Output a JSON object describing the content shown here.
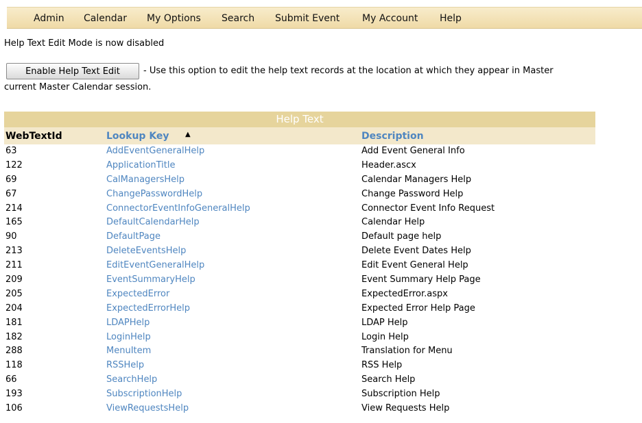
{
  "menu": [
    {
      "label": "Admin"
    },
    {
      "label": "Calendar"
    },
    {
      "label": "My Options"
    },
    {
      "label": "Search"
    },
    {
      "label": "Submit Event"
    },
    {
      "label": "My Account"
    },
    {
      "label": "Help"
    }
  ],
  "status_message": "Help Text Edit Mode is now disabled",
  "enable_button_label": "Enable Help Text Edit",
  "description_line1": "- Use this option to edit the help text records at the location at which they appear in Master",
  "description_line2": "current Master Calendar session.",
  "table": {
    "title": "Help Text",
    "headers": {
      "id": "WebTextId",
      "key": "Lookup Key",
      "desc": "Description",
      "sort_indicator": "▲"
    },
    "rows": [
      {
        "id": "63",
        "key": "AddEventGeneralHelp",
        "desc": "Add Event General Info"
      },
      {
        "id": "122",
        "key": "ApplicationTitle",
        "desc": "Header.ascx"
      },
      {
        "id": "69",
        "key": "CalManagersHelp",
        "desc": "Calendar Managers Help"
      },
      {
        "id": "67",
        "key": "ChangePasswordHelp",
        "desc": "Change Password Help"
      },
      {
        "id": "214",
        "key": "ConnectorEventInfoGeneralHelp",
        "desc": "Connector Event Info Request"
      },
      {
        "id": "165",
        "key": "DefaultCalendarHelp",
        "desc": "Calendar Help"
      },
      {
        "id": "90",
        "key": "DefaultPage",
        "desc": "Default page help"
      },
      {
        "id": "213",
        "key": "DeleteEventsHelp",
        "desc": "Delete Event Dates Help"
      },
      {
        "id": "211",
        "key": "EditEventGeneralHelp",
        "desc": "Edit Event General Help"
      },
      {
        "id": "209",
        "key": "EventSummaryHelp",
        "desc": "Event Summary Help Page"
      },
      {
        "id": "205",
        "key": "ExpectedError",
        "desc": "ExpectedError.aspx"
      },
      {
        "id": "204",
        "key": "ExpectedErrorHelp",
        "desc": "Expected Error Help Page"
      },
      {
        "id": "181",
        "key": "LDAPHelp",
        "desc": "LDAP Help"
      },
      {
        "id": "182",
        "key": "LoginHelp",
        "desc": "Login Help"
      },
      {
        "id": "288",
        "key": "MenuItem",
        "desc": "Translation for Menu"
      },
      {
        "id": "118",
        "key": "RSSHelp",
        "desc": "RSS Help"
      },
      {
        "id": "66",
        "key": "SearchHelp",
        "desc": "Search Help"
      },
      {
        "id": "193",
        "key": "SubscriptionHelp",
        "desc": "Subscription Help"
      },
      {
        "id": "106",
        "key": "ViewRequestsHelp",
        "desc": "View Requests Help"
      }
    ]
  },
  "colors": {
    "menu_bg": "#efdaa7",
    "table_title_bg": "#e6d49c",
    "header_bg": "#f3e8cb",
    "link": "#4f86c0"
  }
}
